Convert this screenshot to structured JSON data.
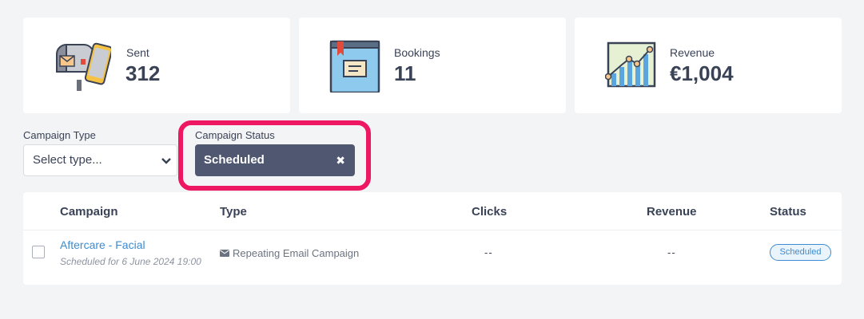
{
  "stats": {
    "sent": {
      "label": "Sent",
      "value": "312",
      "icon": "mailbox-phone-icon"
    },
    "bookings": {
      "label": "Bookings",
      "value": "11",
      "icon": "booking-book-icon"
    },
    "revenue": {
      "label": "Revenue",
      "value": "€1,004",
      "icon": "revenue-chart-icon"
    }
  },
  "filters": {
    "campaign_type": {
      "label": "Campaign Type",
      "placeholder": "Select type..."
    },
    "campaign_status": {
      "label": "Campaign Status",
      "selected": "Scheduled",
      "clear_glyph": "✖"
    }
  },
  "table": {
    "headers": [
      "Campaign",
      "Type",
      "Clicks",
      "Revenue",
      "Status"
    ],
    "rows": [
      {
        "name": "Aftercare - Facial",
        "subtitle": "Scheduled for 6 June 2024 19:00",
        "type": "Repeating Email Campaign",
        "clicks": "--",
        "revenue": "--",
        "status": "Scheduled"
      }
    ]
  },
  "colors": {
    "accent": "#3d8bd0",
    "highlight": "#ee1762",
    "chip": "#4f5870",
    "background": "#f3f4f6"
  }
}
